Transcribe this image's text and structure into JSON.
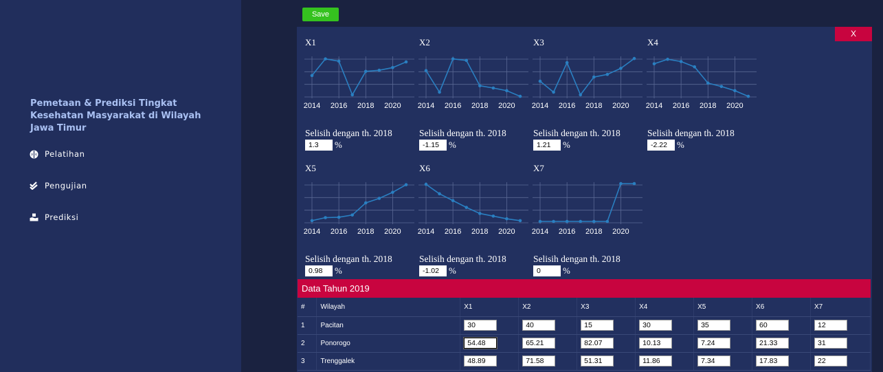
{
  "sidebar": {
    "title": "Pemetaan & Prediksi Tingkat Kesehatan Masyarakat di Wilayah Jawa Timur",
    "nav": [
      {
        "label": "Pelatihan",
        "icon": "brain-icon"
      },
      {
        "label": "Pengujian",
        "icon": "double-check-icon"
      },
      {
        "label": "Prediksi",
        "icon": "hand-box-icon"
      }
    ]
  },
  "toolbar": {
    "save_label": "Save",
    "close_label": "X"
  },
  "colors": {
    "sidebar": "#212e5c",
    "panel": "#22305f",
    "accent_red": "#c8043f",
    "save_green": "#35c21f",
    "line": "#2a7fc1"
  },
  "chart_data": [
    {
      "type": "line",
      "title": "X1",
      "x": [
        2014,
        2015,
        2016,
        2017,
        2018,
        2019,
        2020,
        2021
      ],
      "values": [
        0.53,
        0.97,
        0.91,
        0.02,
        0.64,
        0.67,
        0.74,
        0.89
      ],
      "xticks": [
        "2014",
        "2016",
        "2018",
        "2020"
      ],
      "grid": true
    },
    {
      "type": "line",
      "title": "X2",
      "x": [
        2014,
        2015,
        2016,
        2017,
        2018,
        2019,
        2020,
        2021
      ],
      "values": [
        0.66,
        0.09,
        0.97,
        0.93,
        0.26,
        0.2,
        0.13,
        -0.02
      ],
      "xticks": [
        "2014",
        "2016",
        "2018",
        "2020"
      ],
      "grid": true
    },
    {
      "type": "line",
      "title": "X3",
      "x": [
        2014,
        2015,
        2016,
        2017,
        2018,
        2019,
        2020,
        2021
      ],
      "values": [
        0.38,
        0.09,
        0.87,
        0.02,
        0.49,
        0.56,
        0.72,
        0.98
      ],
      "xticks": [
        "2014",
        "2016",
        "2018",
        "2020"
      ],
      "grid": true
    },
    {
      "type": "line",
      "title": "X4",
      "x": [
        2014,
        2015,
        2016,
        2017,
        2018,
        2019,
        2020,
        2021
      ],
      "values": [
        0.84,
        0.96,
        0.9,
        0.76,
        0.33,
        0.24,
        0.13,
        -0.02
      ],
      "xticks": [
        "2014",
        "2016",
        "2018",
        "2020"
      ],
      "grid": true
    },
    {
      "type": "line",
      "title": "X5",
      "x": [
        2014,
        2015,
        2016,
        2017,
        2018,
        2019,
        2020,
        2021
      ],
      "values": [
        0.02,
        0.1,
        0.11,
        0.17,
        0.49,
        0.61,
        0.77,
        0.97
      ],
      "xticks": [
        "2014",
        "2016",
        "2018",
        "2020"
      ],
      "grid": true
    },
    {
      "type": "line",
      "title": "X6",
      "x": [
        2014,
        2015,
        2016,
        2017,
        2018,
        2019,
        2020,
        2021
      ],
      "values": [
        0.98,
        0.73,
        0.55,
        0.37,
        0.21,
        0.14,
        0.07,
        0.02
      ],
      "xticks": [
        "2014",
        "2016",
        "2018",
        "2020"
      ],
      "grid": true
    },
    {
      "type": "line",
      "title": "X7",
      "x": [
        2014,
        2015,
        2016,
        2017,
        2018,
        2019,
        2020,
        2021
      ],
      "values": [
        0.0,
        0.0,
        0.0,
        0.0,
        0.0,
        0.0,
        1.0,
        1.0
      ],
      "xticks": [
        "2014",
        "2016",
        "2018",
        "2020"
      ],
      "grid": true
    }
  ],
  "diffs": [
    {
      "label": "Selisih dengan th. 2018",
      "value": "1.3",
      "unit": "%"
    },
    {
      "label": "Selisih dengan th. 2018",
      "value": "-1.15",
      "unit": "%"
    },
    {
      "label": "Selisih dengan th. 2018",
      "value": "1.21",
      "unit": "%"
    },
    {
      "label": "Selisih dengan th. 2018",
      "value": "-2.22",
      "unit": "%"
    },
    {
      "label": "Selisih dengan th. 2018",
      "value": "0.98",
      "unit": "%"
    },
    {
      "label": "Selisih dengan th. 2018",
      "value": "-1.02",
      "unit": "%"
    },
    {
      "label": "Selisih dengan th. 2018",
      "value": "0",
      "unit": "%"
    }
  ],
  "table": {
    "title": "Data Tahun 2019",
    "headers": [
      "#",
      "Wilayah",
      "X1",
      "X2",
      "X3",
      "X4",
      "X5",
      "X6",
      "X7"
    ],
    "rows": [
      {
        "no": "1",
        "wilayah": "Pacitan",
        "values": [
          "30",
          "40",
          "15",
          "30",
          "35",
          "60",
          "12"
        ]
      },
      {
        "no": "2",
        "wilayah": "Ponorogo",
        "values": [
          "54.48",
          "65.21",
          "82.07",
          "10.13",
          "7.24",
          "21.33",
          "31"
        ]
      },
      {
        "no": "3",
        "wilayah": "Trenggalek",
        "values": [
          "48.89",
          "71.58",
          "51.31",
          "11.86",
          "7.34",
          "17.83",
          "22"
        ]
      }
    ]
  }
}
